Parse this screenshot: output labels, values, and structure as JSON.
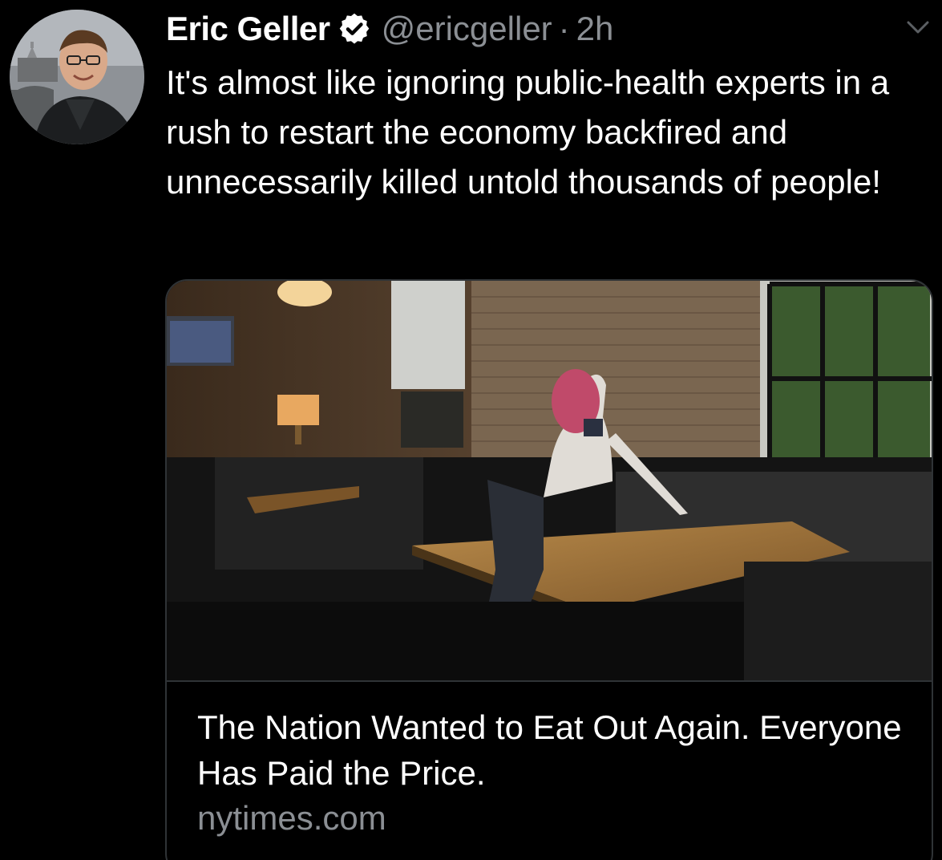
{
  "author": {
    "display_name": "Eric Geller",
    "handle": "@ericgeller",
    "separator": "·",
    "time": "2h",
    "verified": true,
    "avatar_icon": "profile-photo"
  },
  "tweet": {
    "text": "It's almost like ignoring public-health experts in a rush to restart the economy backfired and unnecessarily killed untold thousands of people!"
  },
  "card": {
    "image_icon": "restaurant-photo",
    "title": "The Nation Wanted to Eat Out Again. Everyone Has Paid the Price.",
    "domain": "nytimes.com"
  },
  "icons": {
    "verified": "verified-badge-icon",
    "menu": "chevron-down-icon"
  },
  "colors": {
    "background": "#000000",
    "text": "#ffffff",
    "secondary_text": "#8b8f94",
    "border": "#2f3336"
  }
}
